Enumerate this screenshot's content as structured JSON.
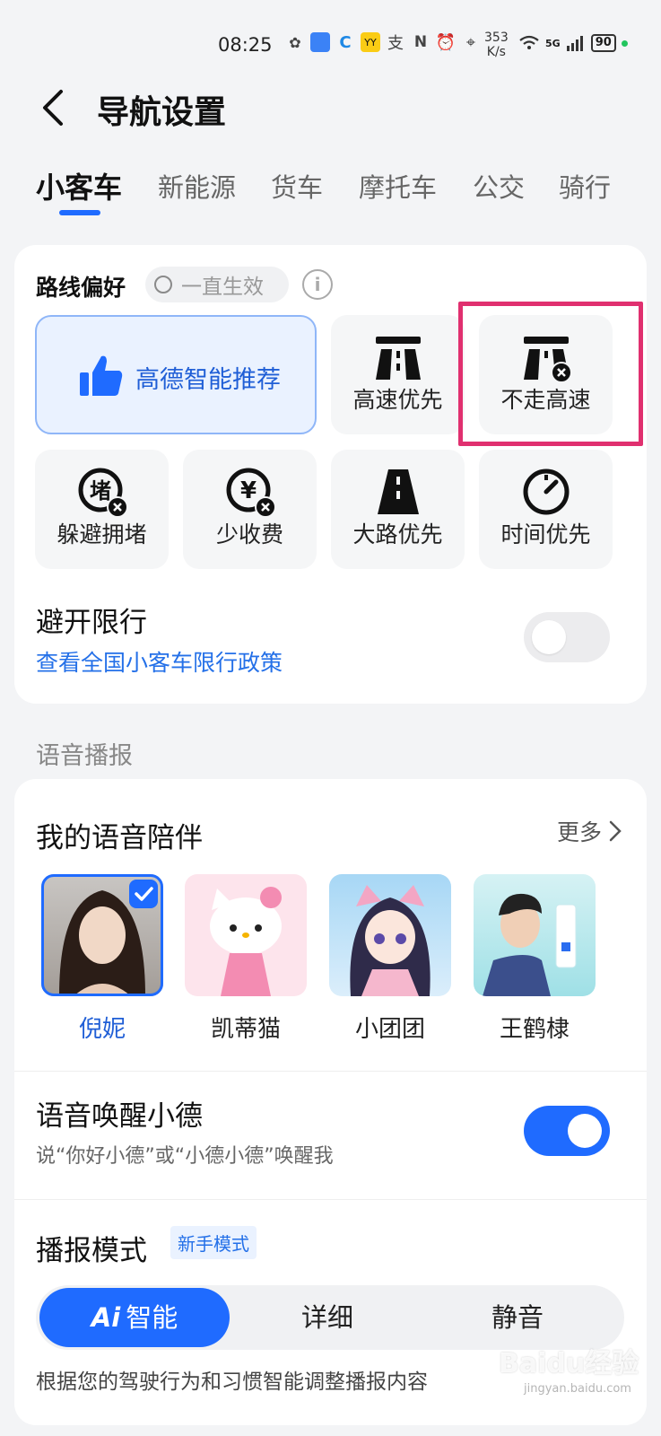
{
  "status": {
    "time": "08:25",
    "net_speed_value": "353",
    "net_speed_unit": "K/s",
    "battery": "90",
    "network": "5G"
  },
  "header": {
    "title": "导航设置"
  },
  "tabs": [
    {
      "label": "小客车",
      "active": true
    },
    {
      "label": "新能源"
    },
    {
      "label": "货车"
    },
    {
      "label": "摩托车"
    },
    {
      "label": "公交"
    },
    {
      "label": "骑行"
    }
  ],
  "route": {
    "title": "路线偏好",
    "always_label": "一直生效",
    "info": "i",
    "options": [
      {
        "label": "高德智能推荐",
        "icon": "thumbs-up-icon",
        "selected": true
      },
      {
        "label": "高速优先",
        "icon": "highway-icon"
      },
      {
        "label": "不走高速",
        "icon": "no-highway-icon",
        "highlighted": true
      },
      {
        "label": "躲避拥堵",
        "icon": "avoid-congestion-icon"
      },
      {
        "label": "少收费",
        "icon": "less-toll-icon"
      },
      {
        "label": "大路优先",
        "icon": "main-road-icon"
      },
      {
        "label": "时间优先",
        "icon": "timer-icon"
      }
    ],
    "avoid_limit_title": "避开限行",
    "avoid_limit_link": "查看全国小客车限行政策",
    "avoid_limit_on": false
  },
  "voice_section_label": "语音播报",
  "voice": {
    "title": "我的语音陪伴",
    "more": "更多",
    "items": [
      {
        "name": "倪妮",
        "selected": true
      },
      {
        "name": "凯蒂猫"
      },
      {
        "name": "小团团"
      },
      {
        "name": "王鹤棣"
      }
    ],
    "wake_title": "语音唤醒小德",
    "wake_sub": "说“你好小德”或“小德小德”唤醒我",
    "wake_on": true,
    "mode_title": "播报模式",
    "mode_badge": "新手模式",
    "modes": [
      "智能",
      "详细",
      "静音"
    ],
    "mode_ai_mark": "Ai",
    "mode_desc": "根据您的驾驶行为和习惯智能调整播报内容"
  },
  "watermark": {
    "text": "Baidu经验",
    "sub": "jingyan.baidu.com"
  },
  "colors": {
    "accent": "#1f6bff",
    "highlight": "#e0306f"
  }
}
